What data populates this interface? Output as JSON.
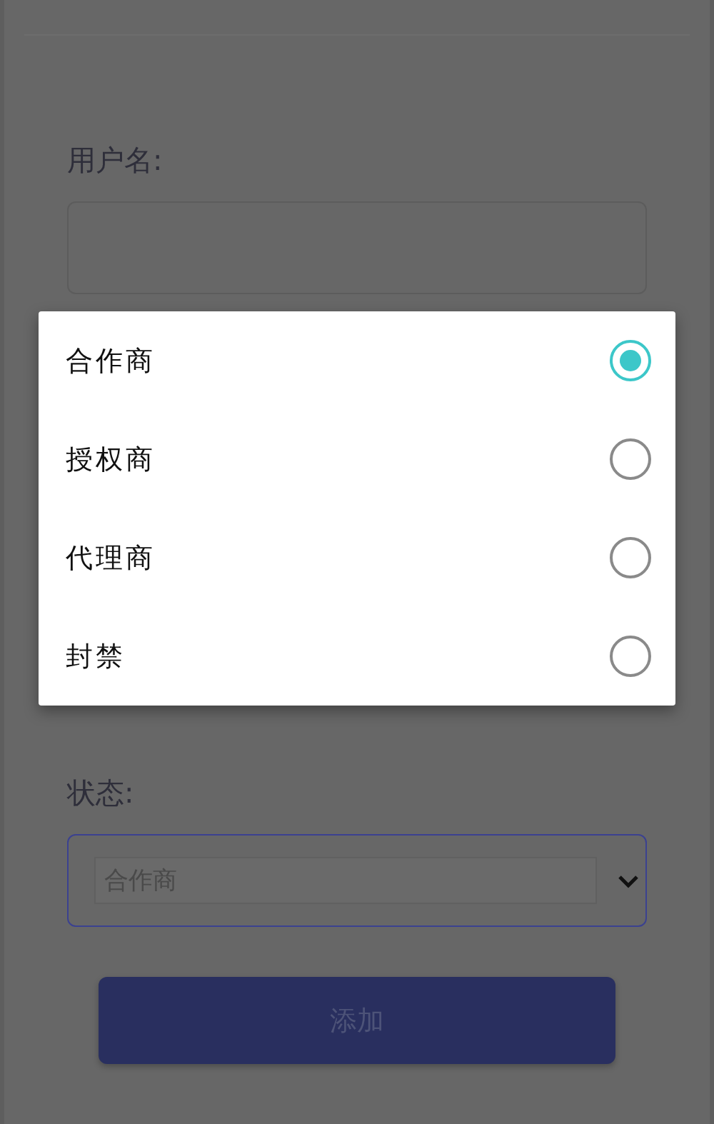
{
  "form": {
    "username_label": "用户名:",
    "status_label": "状态:",
    "status_value": "合作商",
    "submit": "添加"
  },
  "dialog": {
    "options": [
      {
        "label": "合作商",
        "selected": true
      },
      {
        "label": "授权商",
        "selected": false
      },
      {
        "label": "代理商",
        "selected": false
      },
      {
        "label": "封禁",
        "selected": false
      }
    ]
  }
}
